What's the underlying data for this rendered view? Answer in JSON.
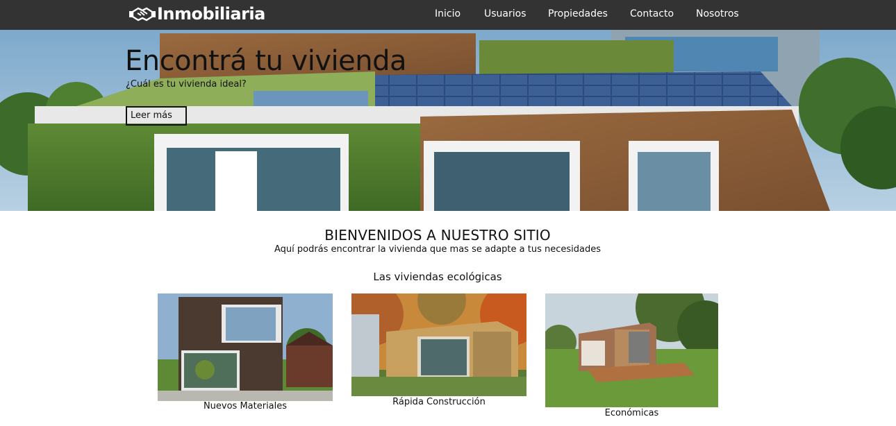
{
  "header": {
    "brand": "Inmobiliaria",
    "logo_icon": "handshake-icon",
    "nav": [
      "Inicio",
      "Usuarios",
      "Propiedades",
      "Contacto",
      "Nosotros"
    ]
  },
  "hero": {
    "title": "Encontrá tu vivienda",
    "subtitle": "¿Cuál es tu vivienda ideal?",
    "button_label": "Leer más"
  },
  "welcome": {
    "title": "BIENVENIDOS A NUESTRO SITIO",
    "subtitle": "Aquí podrás encontrar la vivienda que mas se adapte a tus necesidades"
  },
  "section": {
    "title": "Las viviendas ecológicas",
    "cards": [
      {
        "caption": "Nuevos Materiales"
      },
      {
        "caption": "Rápida Construcción"
      },
      {
        "caption": "Económicas"
      }
    ]
  },
  "colors": {
    "navbar": "#333333",
    "text": "#111111"
  }
}
